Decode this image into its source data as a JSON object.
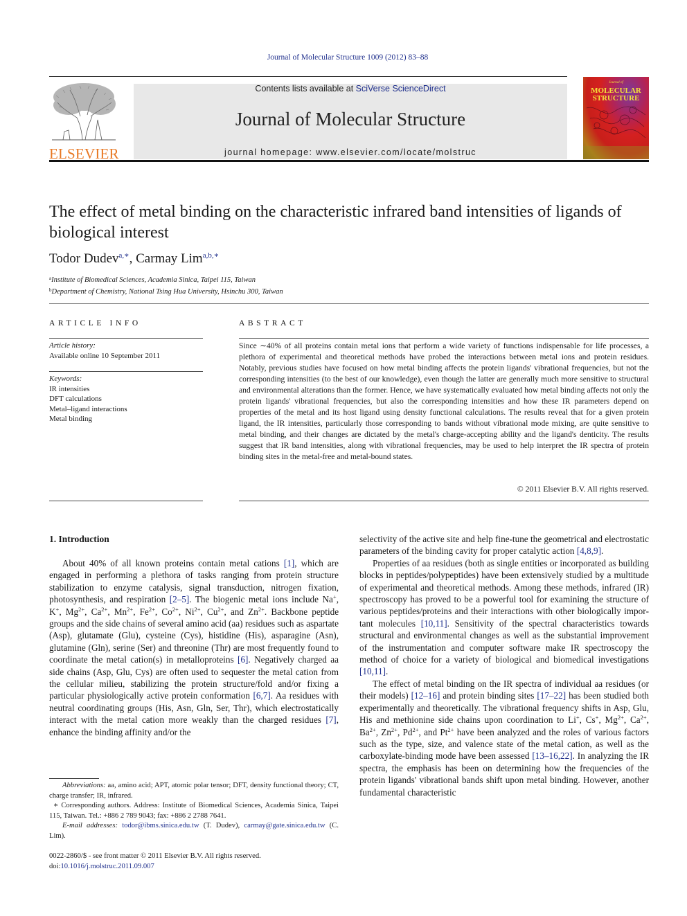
{
  "running_head": "Journal of Molecular Structure 1009 (2012) 83–88",
  "publisher": {
    "logo_text": "ELSEVIER",
    "logo_color": "#e87722"
  },
  "banner": {
    "contents_prefix": "Contents lists available at ",
    "contents_link": "SciVerse ScienceDirect",
    "journal_name": "Journal of Molecular Structure",
    "homepage_prefix": "journal homepage: ",
    "homepage_url": "www.elsevier.com/locate/molstruc"
  },
  "cover": {
    "small_text": "Journal of",
    "title_line1": "MOLECULAR",
    "title_line2": "STRUCTURE"
  },
  "article": {
    "title": "The effect of metal binding on the characteristic infrared band intensities of ligands of biological interest",
    "authors": [
      {
        "name": "Todor Dudev",
        "marks": "a,∗"
      },
      {
        "name": "Carmay Lim",
        "marks": "a,b,∗"
      }
    ],
    "author_separator": ", ",
    "affiliations": [
      {
        "mark": "a",
        "text": "Institute of Biomedical Sciences, Academia Sinica, Taipei 115, Taiwan"
      },
      {
        "mark": "b",
        "text": "Department of Chemistry, National Tsing Hua University, Hsinchu 300, Taiwan"
      }
    ]
  },
  "article_info": {
    "heading": "ARTICLE INFO",
    "history_label": "Article history:",
    "history_value": "Available online 10 September 2011",
    "keywords_label": "Keywords:",
    "keywords": [
      "IR intensities",
      "DFT calculations",
      "Metal–ligand interactions",
      "Metal binding"
    ]
  },
  "abstract": {
    "heading": "ABSTRACT",
    "text": "Since ∼40% of all proteins contain metal ions that perform a wide variety of functions indispensable for life processes, a plethora of experimental and theoretical methods have probed the interactions between metal ions and protein residues. Notably, previous studies have focused on how metal binding affects the protein ligands' vibrational frequencies, but not the corresponding intensities (to the best of our knowl­edge), even though the latter are generally much more sensitive to structural and environmental altera­tions than the former. Hence, we have systematically evaluated how metal binding affects not only the protein ligands' vibrational frequencies, but also the corresponding intensities and how these IR param­eters depend on properties of the metal and its host ligand using density functional calculations. The results reveal that for a given protein ligand, the IR intensities, particularly those corresponding to bands without vibrational mode mixing, are quite sensitive to metal binding, and their changes are dictated by the metal's charge-accepting ability and the ligand's denticity. The results suggest that IR band intensi­ties, along with vibrational frequencies, may be used to help interpret the IR spectra of protein binding sites in the metal-free and metal-bound states.",
    "copyright": "© 2011 Elsevier B.V. All rights reserved."
  },
  "introduction": {
    "heading": "1. Introduction",
    "left_paragraphs": [
      [
        {
          "t": "About 40% of all known proteins contain metal cations "
        },
        {
          "t": "[1]",
          "link": true
        },
        {
          "t": ", which are engaged in performing a plethora of tasks ranging from protein structure stabilization to enzyme catalysis, signal trans­duction, nitrogen fixation, photosynthesis, and respiration "
        },
        {
          "t": "[2–5]",
          "link": true
        },
        {
          "t": ". The biogenic metal ions include Na"
        },
        {
          "t": "+",
          "sup": true
        },
        {
          "t": ", K"
        },
        {
          "t": "+",
          "sup": true
        },
        {
          "t": ", Mg"
        },
        {
          "t": "2+",
          "sup": true
        },
        {
          "t": ", Ca"
        },
        {
          "t": "2+",
          "sup": true
        },
        {
          "t": ", Mn"
        },
        {
          "t": "2+",
          "sup": true
        },
        {
          "t": ", Fe"
        },
        {
          "t": "2+",
          "sup": true
        },
        {
          "t": ", Co"
        },
        {
          "t": "2+",
          "sup": true
        },
        {
          "t": ", Ni"
        },
        {
          "t": "2+",
          "sup": true
        },
        {
          "t": ", Cu"
        },
        {
          "t": "2+",
          "sup": true
        },
        {
          "t": ", and Zn"
        },
        {
          "t": "2+",
          "sup": true
        },
        {
          "t": ". Backbone peptide groups and the side chains of several amino acid (aa) residues such as aspartate (Asp), glutamate (Glu), cysteine (Cys), histidine (His), asparagine (Asn), glutamine (Gln), serine (Ser) and threonine (Thr) are most frequently found to coordinate the metal cation(s) in metallopro­teins "
        },
        {
          "t": "[6]",
          "link": true
        },
        {
          "t": ". Negatively charged aa side chains (Asp, Glu, Cys) are often used to sequester the metal cation from the cellular milieu, stabi­lizing the protein structure/fold and/or fixing a particular physio­logically active protein conformation "
        },
        {
          "t": "[6,7]",
          "link": true
        },
        {
          "t": ". Aa residues with neutral coordinating groups (His, Asn, Gln, Ser, Thr), which electro­statically interact with the metal cation more weakly than the charged residues "
        },
        {
          "t": "[7]",
          "link": true
        },
        {
          "t": ", enhance the binding affinity and/or the"
        }
      ]
    ],
    "right_paragraphs": [
      [
        {
          "t": "selectivity of the active site and help fine-tune the geometrical and electrostatic parameters of the binding cavity for proper cata­lytic action "
        },
        {
          "t": "[4,8,9]",
          "link": true
        },
        {
          "t": "."
        }
      ],
      [
        {
          "t": "Properties of aa residues (both as single entities or incorporated as building blocks in peptides/polypeptides) have been extensively studied by a multitude of experimental and theoretical methods. Among these methods, infrared (IR) spectroscopy has proved to be a powerful tool for examining the structure of various pep­tides/proteins and their interactions with other biologically impor­tant molecules "
        },
        {
          "t": "[10,11]",
          "link": true
        },
        {
          "t": ". Sensitivity of the spectral characteristics towards structural and environmental changes as well as the sub­stantial improvement of the instrumentation and computer soft­ware make IR spectroscopy the method of choice for a variety of biological and biomedical investigations "
        },
        {
          "t": "[10,11]",
          "link": true
        },
        {
          "t": "."
        }
      ],
      [
        {
          "t": "The effect of metal binding on the IR spectra of individual aa residues (or their models) "
        },
        {
          "t": "[12–16]",
          "link": true
        },
        {
          "t": " and protein binding sites "
        },
        {
          "t": "[17–22]",
          "link": true
        },
        {
          "t": " has been studied both experimentally and theoretically. The vibrational frequency shifts in Asp, Glu, His and methionine side chains upon coordination to Li"
        },
        {
          "t": "+",
          "sup": true
        },
        {
          "t": ", Cs"
        },
        {
          "t": "+",
          "sup": true
        },
        {
          "t": ", Mg"
        },
        {
          "t": "2+",
          "sup": true
        },
        {
          "t": ", Ca"
        },
        {
          "t": "2+",
          "sup": true
        },
        {
          "t": ", Ba"
        },
        {
          "t": "2+",
          "sup": true
        },
        {
          "t": ", Zn"
        },
        {
          "t": "2+",
          "sup": true
        },
        {
          "t": ", Pd"
        },
        {
          "t": "2+",
          "sup": true
        },
        {
          "t": ", and Pt"
        },
        {
          "t": "2+",
          "sup": true
        },
        {
          "t": " have been analyzed and the roles of various factors such as the type, size, and valence state of the metal cation, as well as the carboxylate-binding mode have been assessed "
        },
        {
          "t": "[13–16,22]",
          "link": true
        },
        {
          "t": ". In analyzing the IR spectra, the emphasis has been on determining how the frequencies of the protein ligands' vibrational bands shift upon metal binding. However, another fundamental characteristic"
        }
      ]
    ]
  },
  "footnotes": {
    "abbreviations_label": "Abbreviations:",
    "abbreviations_text": " aa, amino acid; APT, atomic polar tensor; DFT, density functional theory; CT, charge transfer; IR, infrared.",
    "corresponding_mark": "∗",
    "corresponding_text": " Corresponding authors. Address: Institute of Biomedical Sciences, Academia Sinica, Taipei 115, Taiwan. Tel.: +886 2 789 9043; fax: +886 2 2788 7641.",
    "email_label": "E-mail addresses:",
    "email1": "todor@ibms.sinica.edu.tw",
    "email1_owner": " (T. Dudev), ",
    "email2": "carmay@gate.sinica.edu.tw",
    "email2_owner": " (C. Lim)."
  },
  "front_matter": {
    "issn_line": "0022-2860/$ - see front matter © 2011 Elsevier B.V. All rights reserved.",
    "doi_prefix": "doi:",
    "doi": "10.1016/j.molstruc.2011.09.007"
  }
}
